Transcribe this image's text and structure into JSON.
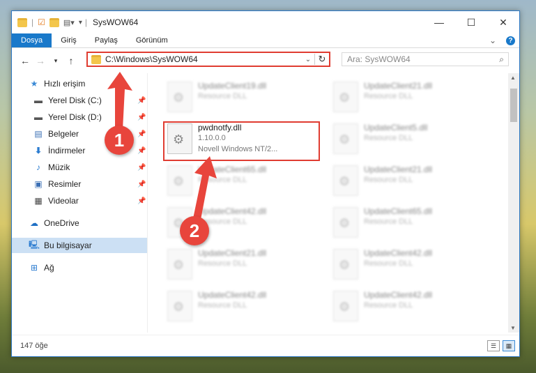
{
  "window": {
    "title": "SysWOW64"
  },
  "ribbon": {
    "tabs": [
      "Dosya",
      "Giriş",
      "Paylaş",
      "Görünüm"
    ]
  },
  "address": {
    "path": "C:\\Windows\\SysWOW64"
  },
  "search": {
    "placeholder": "Ara: SysWOW64"
  },
  "sidebar": {
    "items": [
      {
        "label": "Hızlı erişim",
        "icon": "star-icon"
      },
      {
        "label": "Yerel Disk (C:)",
        "icon": "drive-icon"
      },
      {
        "label": "Yerel Disk (D:)",
        "icon": "drive-icon"
      },
      {
        "label": "Belgeler",
        "icon": "documents-icon"
      },
      {
        "label": "İndirmeler",
        "icon": "download-icon"
      },
      {
        "label": "Müzik",
        "icon": "music-icon"
      },
      {
        "label": "Resimler",
        "icon": "pictures-icon"
      },
      {
        "label": "Videolar",
        "icon": "video-icon"
      },
      {
        "label": "OneDrive",
        "icon": "cloud-icon"
      },
      {
        "label": "Bu bilgisayar",
        "icon": "computer-icon"
      },
      {
        "label": "Ağ",
        "icon": "network-icon"
      }
    ]
  },
  "files": [
    {
      "name": "UpdateClient19.dll",
      "line1": "Resource DLL",
      "line2": ""
    },
    {
      "name": "UpdateClient21.dll",
      "line1": "Resource DLL",
      "line2": ""
    },
    {
      "name": "pwdnotfy.dll",
      "line1": "1.10.0.0",
      "line2": "Novell Windows NT/2..."
    },
    {
      "name": "UpdateClient5.dll",
      "line1": "Resource DLL",
      "line2": ""
    },
    {
      "name": "UpdateClient65.dll",
      "line1": "Resource DLL",
      "line2": ""
    },
    {
      "name": "UpdateClient21.dll",
      "line1": "Resource DLL",
      "line2": ""
    },
    {
      "name": "UpdateClient42.dll",
      "line1": "Resource DLL",
      "line2": ""
    },
    {
      "name": "UpdateClient65.dll",
      "line1": "Resource DLL",
      "line2": ""
    },
    {
      "name": "UpdateClient21.dll",
      "line1": "Resource DLL",
      "line2": ""
    },
    {
      "name": "UpdateClient42.dll",
      "line1": "Resource DLL",
      "line2": ""
    },
    {
      "name": "UpdateClient42.dll",
      "line1": "Resource DLL",
      "line2": ""
    },
    {
      "name": "UpdateClient42.dll",
      "line1": "Resource DLL",
      "line2": ""
    }
  ],
  "status": {
    "count": "147 öğe"
  },
  "markers": [
    "1",
    "2"
  ],
  "colors": {
    "accent": "#1979ca",
    "highlight": "#e03c31"
  }
}
